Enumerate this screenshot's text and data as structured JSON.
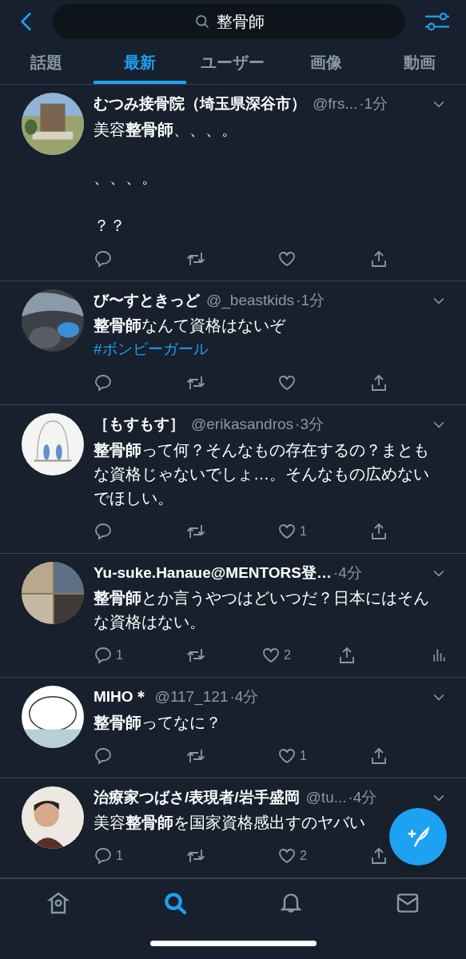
{
  "search": {
    "value": "整骨師"
  },
  "tabs": [
    {
      "label": "話題",
      "selected": false
    },
    {
      "label": "最新",
      "selected": true
    },
    {
      "label": "ユーザー",
      "selected": false
    },
    {
      "label": "画像",
      "selected": false
    },
    {
      "label": "動画",
      "selected": false
    }
  ],
  "tweets": [
    {
      "name": "むつみ接骨院（埼玉県深谷市）",
      "handle": "@frs...",
      "time": "·1分",
      "paragraphs": [
        "美容**整骨師**、、、。",
        "、、、。",
        "？？"
      ],
      "analytics": false
    },
    {
      "name": "び〜すときっど",
      "handle": "@_beastkids",
      "time": "·1分",
      "paragraphs": [
        "**整骨師**なんて資格はないぞ"
      ],
      "hashtag": "#ボンビーガール",
      "analytics": false
    },
    {
      "name": "［もすもす］",
      "handle": "@erikasandros",
      "time": "·3分",
      "paragraphs": [
        "**整骨師**って何？そんなもの存在するの？まともな資格じゃないでしょ…。そんなもの広めないでほしい。"
      ],
      "likes": "1",
      "analytics": false
    },
    {
      "name": "Yu-suke.Hanaue@MENTORS登…",
      "time": "·4分",
      "paragraphs": [
        "**整骨師**とか言うやつはどいつだ？日本にはそんな資格はない。"
      ],
      "replies": "1",
      "likes": "2",
      "analytics": true
    },
    {
      "name": "MIHO＊",
      "handle": "@117_121",
      "time": "·4分",
      "paragraphs": [
        "**整骨師**ってなに？"
      ],
      "likes": "1",
      "analytics": false
    },
    {
      "name": "治療家つばさ/表現者/岩手盛岡",
      "handle": "@tu...",
      "time": "·4分",
      "paragraphs": [
        "美容**整骨師**を国家資格感出すのヤバい"
      ],
      "replies": "1",
      "likes": "2",
      "analytics": false
    }
  ],
  "nav": [
    {
      "kind": "home",
      "selected": false
    },
    {
      "kind": "search",
      "selected": true
    },
    {
      "kind": "bell",
      "selected": false
    },
    {
      "kind": "mail",
      "selected": false
    }
  ]
}
